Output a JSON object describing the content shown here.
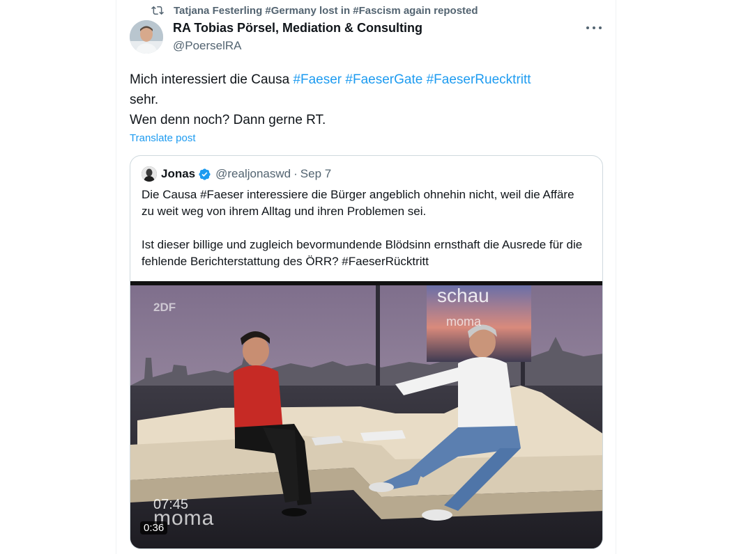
{
  "repost": {
    "text": "Tatjana Festerling #Germany lost in #Fascism again reposted",
    "icon": "repost-icon"
  },
  "post": {
    "display_name": "RA Tobias Pörsel, Mediation & Consulting",
    "handle": "@PoerselRA",
    "text_start": "Mich interessiert die Causa ",
    "hashtags": [
      "#Faeser",
      "#FaeserGate",
      "#FaeserRuecktritt"
    ],
    "text_line2": "sehr.",
    "text_line3": "Wen denn noch? Dann gerne RT.",
    "translate_label": "Translate post",
    "more_icon": "more-icon"
  },
  "quote": {
    "name": "Jonas",
    "handle": "@realjonaswd",
    "separator": "·",
    "date": "Sep 7",
    "paragraph1": "Die Causa #Faeser interessiere die Bürger angeblich ohnehin nicht, weil die Affäre zu weit weg von ihrem Alltag und ihren Problemen sei.",
    "paragraph2": "Ist dieser billige und zugleich bevormundende Blödsinn ernsthaft die Ausrede für die fehlende Berichterstattung des ÖRR? #FaeserRücktritt",
    "verified_icon": "verified-badge-icon"
  },
  "video": {
    "duration": "0:36",
    "overlay_time": "07:45",
    "overlay_show": "moma",
    "backdrop_text_1": "schau",
    "backdrop_text_2": "moma",
    "channel_logo": "2DF"
  },
  "colors": {
    "link": "#1d9bf0",
    "secondary": "#536471",
    "border": "#cfd9de",
    "verified": "#1d9bf0"
  }
}
